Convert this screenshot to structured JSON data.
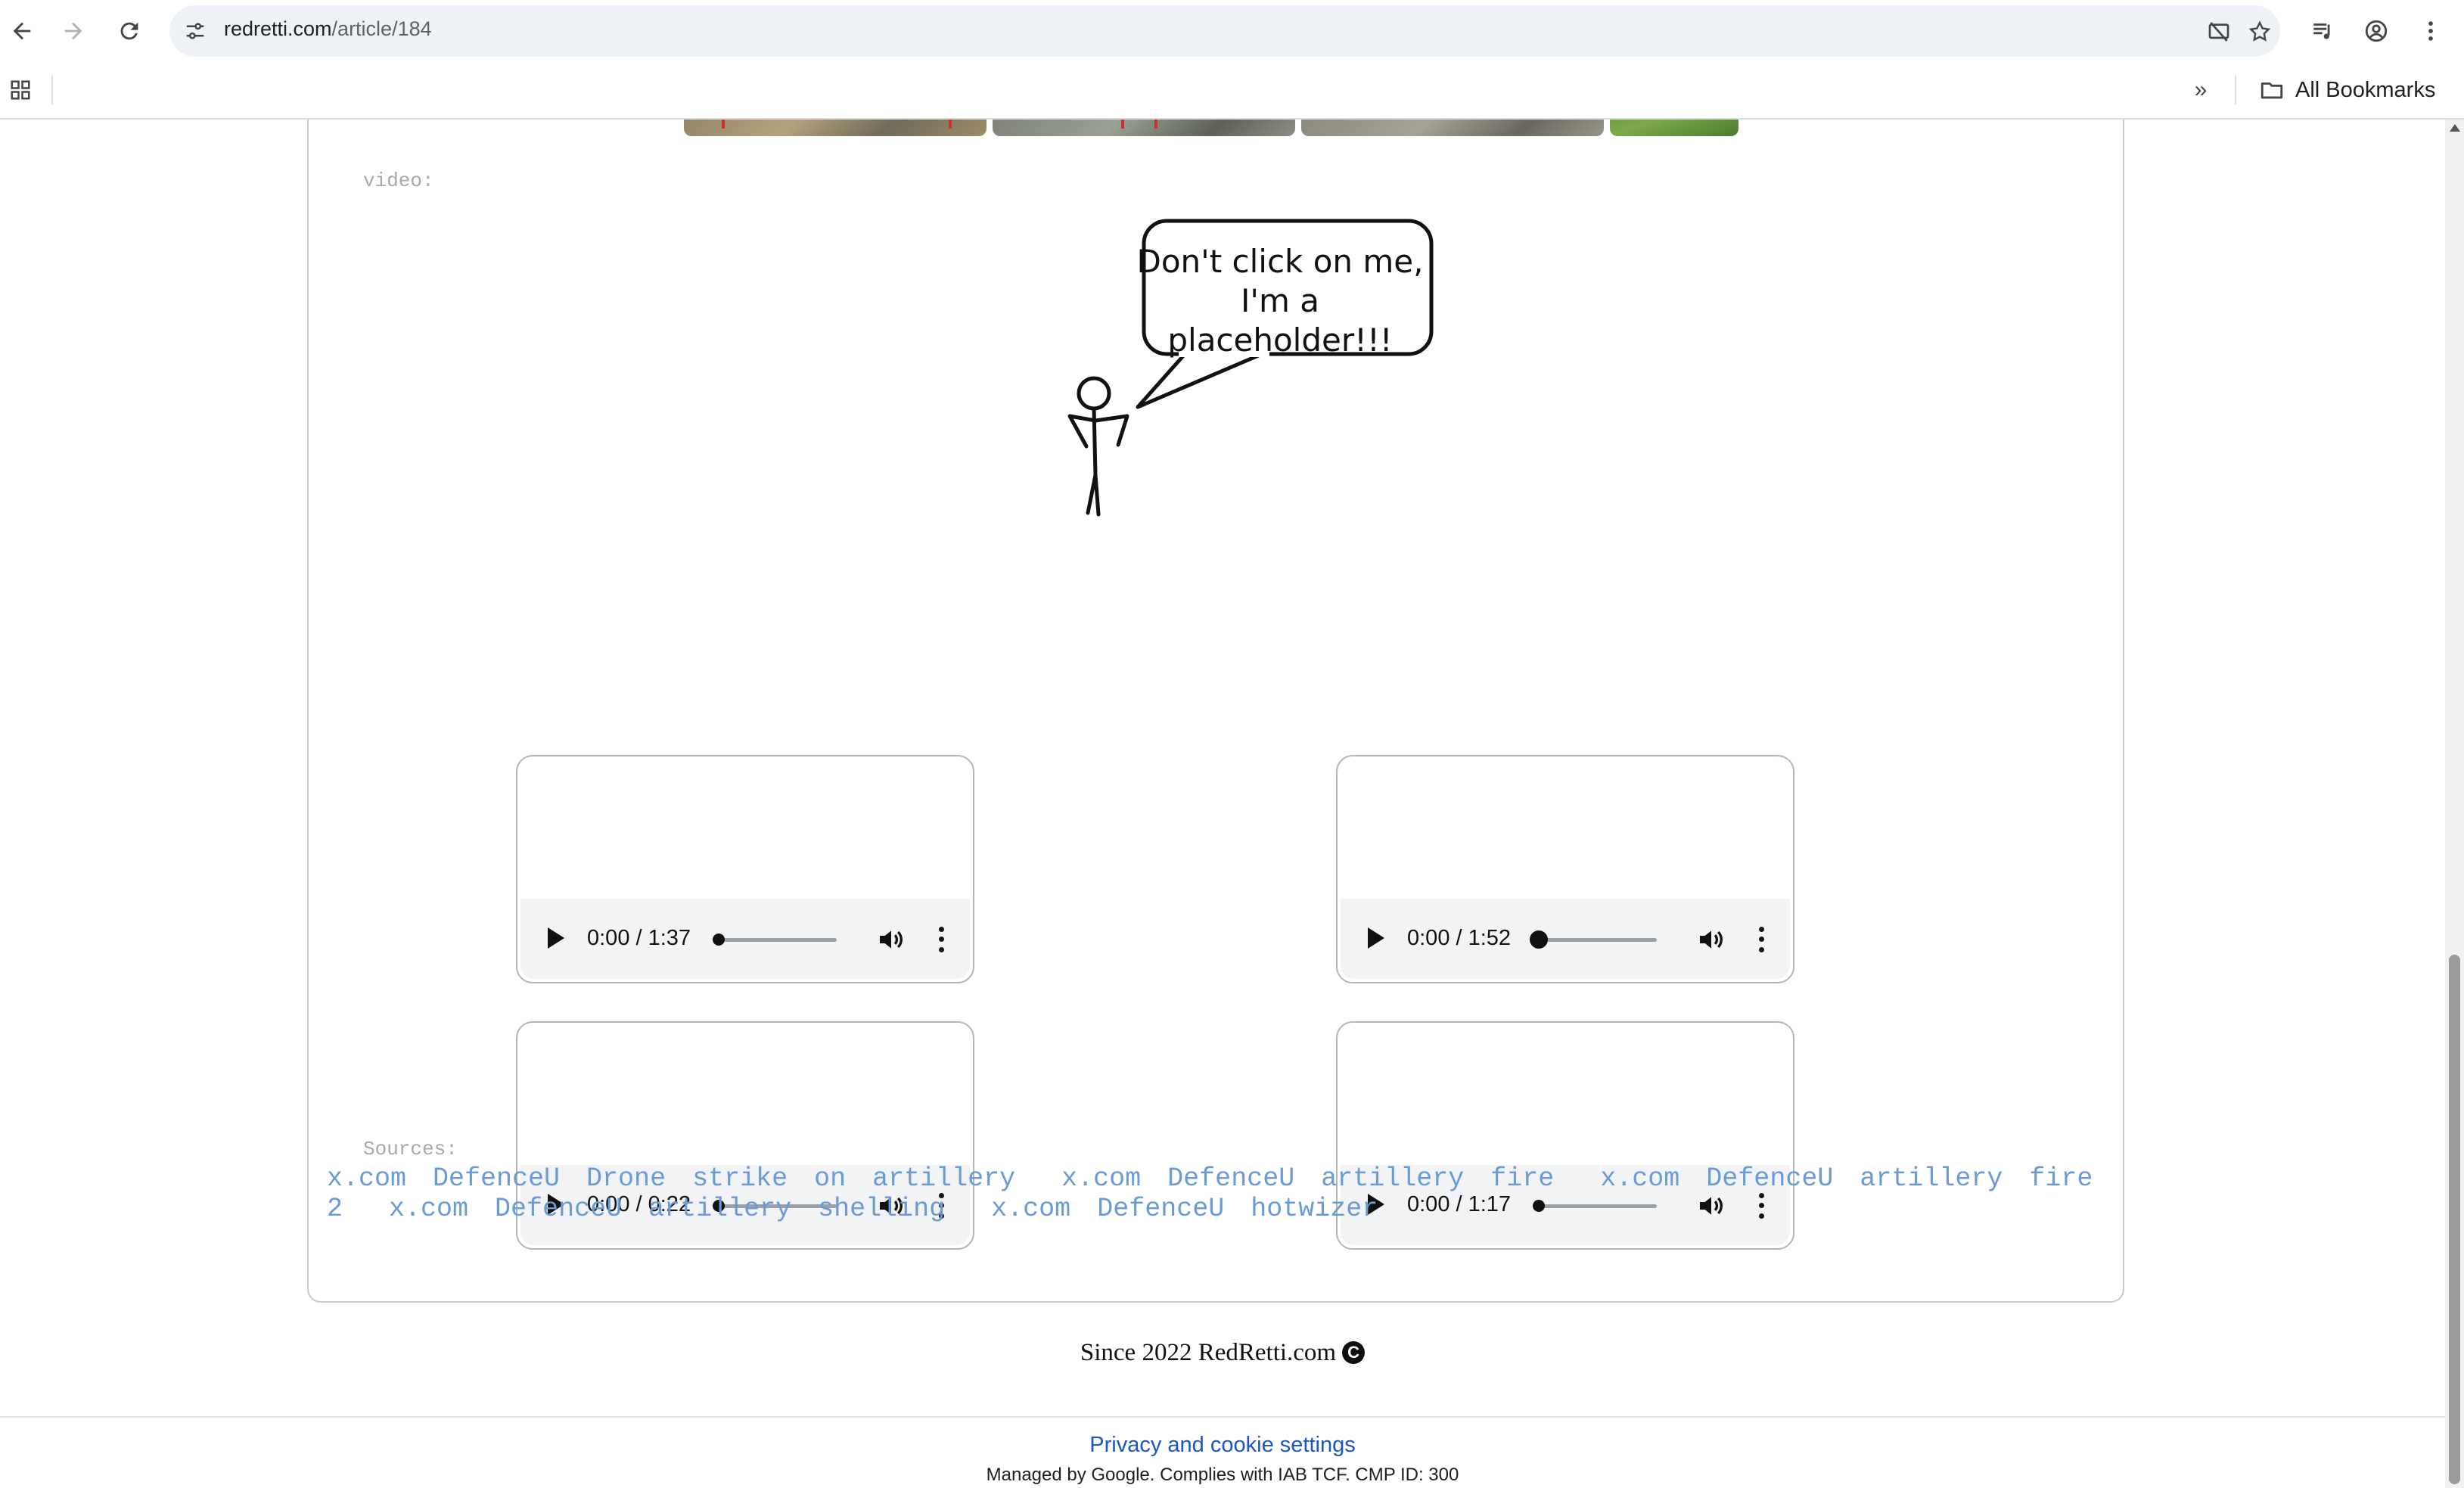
{
  "browser": {
    "url_domain": "redretti.com",
    "url_path": "/article/184",
    "bookmarks_label": "All Bookmarks"
  },
  "article": {
    "video_label": "video:",
    "placeholder_bubble": [
      "Don't click on me,",
      "I'm a placeholder!!!"
    ],
    "audio_players": [
      {
        "time": "0:00 / 1:37",
        "progress": 0.0
      },
      {
        "time": "0:00 / 1:52",
        "progress": 0.0
      },
      {
        "time": "0:00 / 0:22",
        "progress": 0.0
      },
      {
        "time": "0:00 / 1:17",
        "progress": 0.0
      }
    ],
    "sources_label": "Sources:",
    "sources": [
      "x.com DefenceU Drone strike on artillery",
      "x.com DefenceU artillery fire",
      "x.com DefenceU artillery fire 2",
      "x.com DefenceU artillery shelling",
      "x.com DefenceU hotwizer"
    ]
  },
  "footer": {
    "since_text": "Since 2022 RedRetti.com",
    "copyright_symbol": "C"
  },
  "consent": {
    "link_text": "Privacy and cookie settings",
    "sub_text": "Managed by Google. Complies with IAB TCF. CMP ID: 300"
  }
}
